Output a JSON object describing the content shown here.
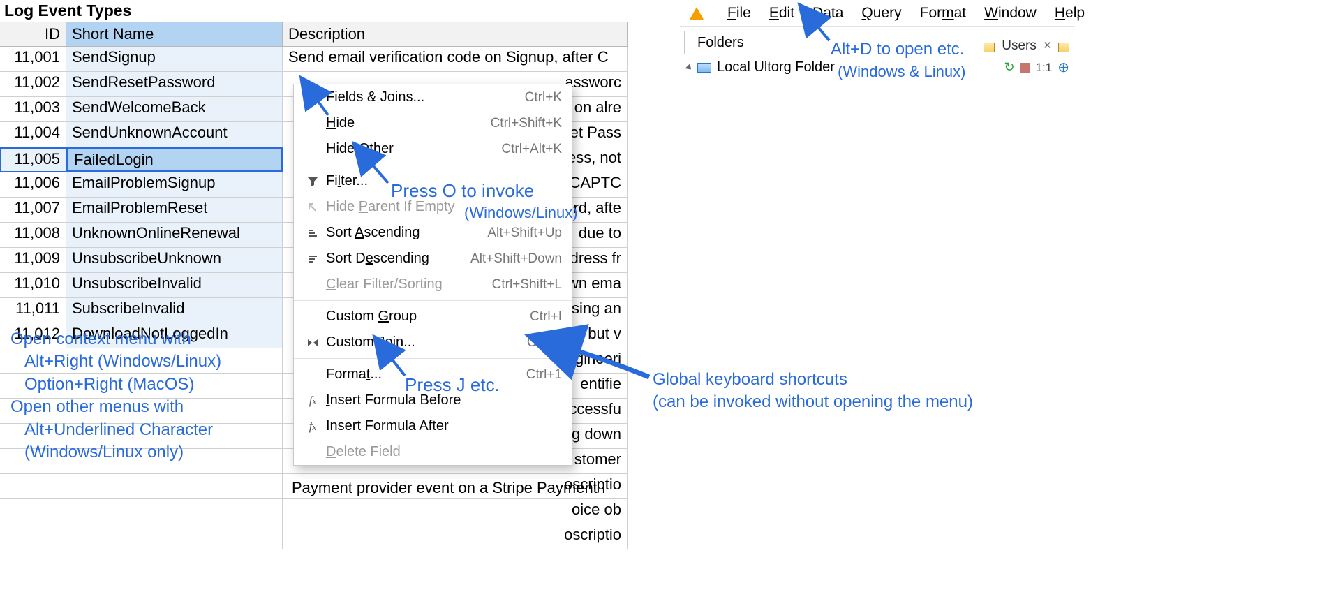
{
  "table": {
    "title": "Log Event Types",
    "columns": {
      "id": "ID",
      "name": "Short Name",
      "desc": "Description"
    },
    "selected_id": 11005,
    "rows": [
      {
        "id": "11,001",
        "name": "SendSignup",
        "desc": "Send email verification code on Signup, after C"
      },
      {
        "id": "11,002",
        "name": "SendResetPassword",
        "desc_tail": "assworc"
      },
      {
        "id": "11,003",
        "name": "SendWelcomeBack",
        "desc_tail": "on alre"
      },
      {
        "id": "11,004",
        "name": "SendUnknownAccount",
        "desc_tail": "set Pass"
      },
      {
        "id": "11,005",
        "name": "FailedLogin",
        "desc_tail": "ess, not"
      },
      {
        "id": "11,006",
        "name": "EmailProblemSignup",
        "desc_tail": "CAPTC"
      },
      {
        "id": "11,007",
        "name": "EmailProblemReset",
        "desc_tail": "rd, afte"
      },
      {
        "id": "11,008",
        "name": "UnknownOnlineRenewal",
        "desc_tail": "due to"
      },
      {
        "id": "11,009",
        "name": "UnsubscribeUnknown",
        "desc_tail": "dress fr"
      },
      {
        "id": "11,010",
        "name": "UnsubscribeInvalid",
        "desc_tail": "wn ema"
      },
      {
        "id": "11,011",
        "name": "SubscribeInvalid",
        "desc_tail": "sing an"
      },
      {
        "id": "11,012",
        "name": "DownloadNotLoggedIn",
        "desc_tail": "on but v"
      }
    ],
    "desc_tails_extra": [
      "gineeri",
      "entifie",
      "ccessfu",
      "g down",
      "stomer",
      "oscriptio",
      "oice ob",
      "oscriptio"
    ],
    "last_desc": "Payment provider event on a Stripe Payment I"
  },
  "contextMenu": {
    "groups": [
      [
        {
          "icon": "",
          "label_html": "Fields & Joins...",
          "accel": "Ctrl+K",
          "disabled": false
        },
        {
          "icon": "",
          "label_html": "<span class='ul'>H</span>ide",
          "accel": "Ctrl+Shift+K",
          "disabled": false
        },
        {
          "icon": "",
          "label_html": "Hide <span class='ul'>O</span>ther",
          "accel": "Ctrl+Alt+K",
          "disabled": false
        }
      ],
      [
        {
          "icon": "filter",
          "label_html": "Fi<span class='ul'>l</span>ter...",
          "accel": "",
          "disabled": false
        },
        {
          "icon": "arrow-tl",
          "label_html": "Hide <span class='ul'>P</span>arent If Empty",
          "accel": "",
          "disabled": true
        },
        {
          "icon": "sort-asc",
          "label_html": "Sort <span class='ul'>A</span>scending",
          "accel": "Alt+Shift+Up",
          "disabled": false
        },
        {
          "icon": "sort-desc",
          "label_html": "Sort D<span class='ul'>e</span>scending",
          "accel": "Alt+Shift+Down",
          "disabled": false
        },
        {
          "icon": "",
          "label_html": "<span class='ul'>C</span>lear Filter/Sorting",
          "accel": "Ctrl+Shift+L",
          "disabled": true
        }
      ],
      [
        {
          "icon": "",
          "label_html": "Custom <span class='ul'>G</span>roup",
          "accel": "Ctrl+I",
          "disabled": false
        },
        {
          "icon": "bowtie",
          "label_html": "Custom <span class='ul'>J</span>oin...",
          "accel": "Ctrl+J",
          "disabled": false
        }
      ],
      [
        {
          "icon": "",
          "label_html": "Forma<span class='ul'>t</span>...",
          "accel": "Ctrl+1",
          "disabled": false
        },
        {
          "icon": "fx",
          "label_html": "<span class='ul'>I</span>nsert Formula Before",
          "accel": "",
          "disabled": false
        },
        {
          "icon": "fx",
          "label_html": "Insert Formula After",
          "accel": "",
          "disabled": false
        },
        {
          "icon": "",
          "label_html": "<span class='ul'>D</span>elete Field",
          "accel": "",
          "disabled": true
        }
      ]
    ]
  },
  "menubar": {
    "items": [
      {
        "label": "File",
        "ul": 0
      },
      {
        "label": "Edit",
        "ul": 0
      },
      {
        "label": "Data",
        "ul": 0
      },
      {
        "label": "Query",
        "ul": 0
      },
      {
        "label": "Format",
        "ul": 3
      },
      {
        "label": "Window",
        "ul": 0
      },
      {
        "label": "Help",
        "ul": 0
      }
    ]
  },
  "foldersPanel": {
    "tab": "Folders",
    "usersTab": "Users",
    "treeRoot": "Local Ultorg Folder",
    "ratio": "1:1"
  },
  "annotations": {
    "left_help": "Open context menu with\n   Alt+Right (Windows/Linux)\n   Option+Right (MacOS)\nOpen other menus with\n   Alt+Underlined Character\n   (Windows/Linux only)",
    "press_o": "Press O to invoke",
    "press_o_sub": "(Windows/Linux)",
    "press_j": "Press J etc.",
    "global": "Global keyboard shortcuts\n(can be invoked without opening the menu)",
    "alt_d": "Alt+D to open etc.",
    "alt_d_sub": "(Windows & Linux)"
  }
}
